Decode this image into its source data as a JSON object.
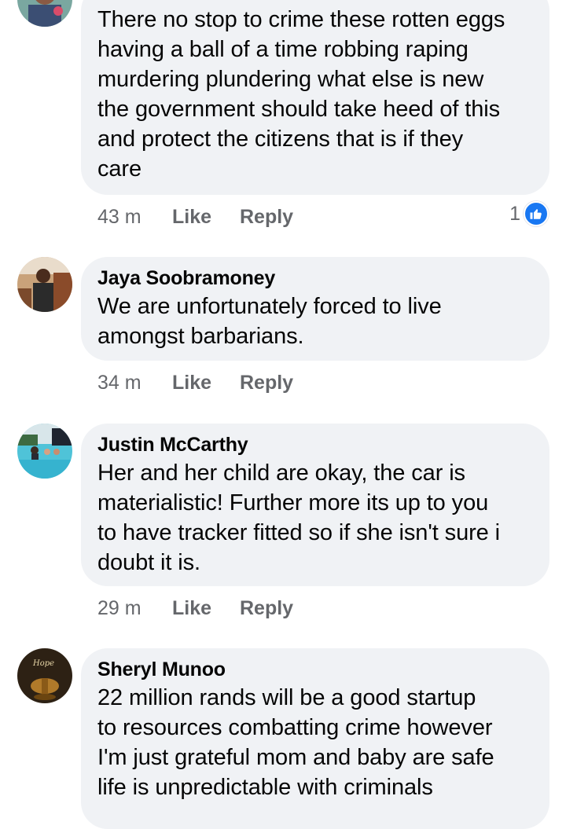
{
  "comments": [
    {
      "author": "",
      "text": "There no stop to crime these rotten eggs\nhaving a ball of a time robbing raping\nmurdering plundering what else is new\nthe government should take heed of this\nand protect the citizens that is if they\ncare",
      "time": "43 m",
      "like": "Like",
      "reply": "Reply",
      "reaction_count": "1"
    },
    {
      "author": "Jaya Soobramoney",
      "text": "We are unfortunately forced to live\namongst barbarians.",
      "time": "34 m",
      "like": "Like",
      "reply": "Reply"
    },
    {
      "author": "Justin McCarthy",
      "text": "Her and her child are okay, the car is\nmaterialistic! Further more its up to you\nto have tracker fitted so if she isn't sure i\ndoubt it is.",
      "time": "29 m",
      "like": "Like",
      "reply": "Reply"
    },
    {
      "author": "Sheryl Munoo",
      "text": "22 million rands will be a good startup\nto  resources combatting crime  however\nI'm just grateful mom and baby are safe\nlife is unpredictable with criminals",
      "time": "",
      "like": "",
      "reply": ""
    }
  ],
  "avatar_texts": {
    "sheryl": "Hope"
  },
  "colors": {
    "bubble": "#f0f2f5",
    "meta": "#65676b",
    "like_blue": "#1877f2"
  },
  "icons": {
    "reaction": "like-thumb-icon"
  }
}
